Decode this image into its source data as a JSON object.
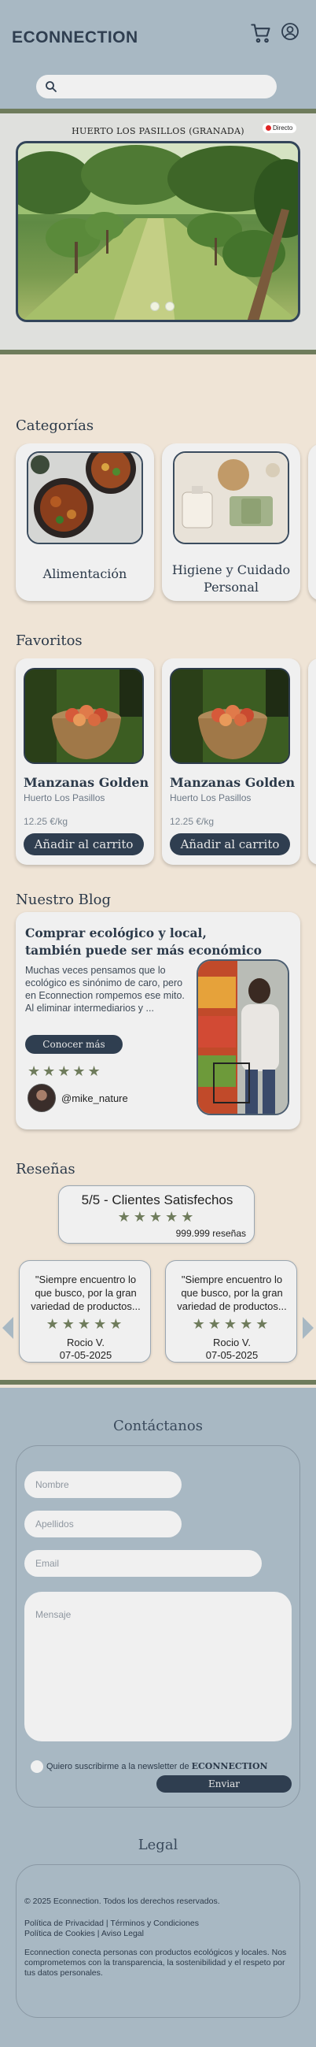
{
  "header": {
    "logo": "ECONNECTION",
    "search_placeholder": "",
    "icons": [
      "cart-icon",
      "user-icon",
      "search-icon"
    ]
  },
  "hero": {
    "title": "HUERTO LOS PASILLOS (GRANADA)",
    "live_label": "Directo",
    "slides_total": 2,
    "active_slide": 1
  },
  "categories": {
    "title": "Categorías",
    "items": [
      {
        "label": "Alimentación"
      },
      {
        "label_line1": "Higiene y Cuidado",
        "label_line2": "Personal"
      }
    ]
  },
  "favorites": {
    "title": "Favoritos",
    "items": [
      {
        "name": "Manzanas Golden",
        "farm": "Huerto Los Pasillos",
        "price": "12.25 €/kg",
        "button": "Añadir al carrito"
      },
      {
        "name": "Manzanas Golden",
        "farm": "Huerto Los Pasillos",
        "price": "12.25 €/kg",
        "button": "Añadir al carrito"
      }
    ]
  },
  "blog": {
    "title": "Nuestro Blog",
    "post_title_line1": "Comprar ecológico y local,",
    "post_title_line2": "también puede ser más económico",
    "excerpt": "Muchas veces pensamos que lo ecológico es sinónimo de caro, pero en Econnection rompemos ese mito. Al eliminar intermediarios y ...",
    "button": "Conocer más",
    "rating": 5,
    "author": "@mike_nature"
  },
  "reviews": {
    "title": "Reseñas",
    "summary": "5/5 - Clientes Satisfechos",
    "summary_rating": 5,
    "count": "999.999 reseñas",
    "items": [
      {
        "quote_line1": "\"Siempre encuentro lo",
        "quote_line2": "que busco, por la gran",
        "quote_line3": "variedad de productos...",
        "rating": 5,
        "author": "Rocio V.",
        "date": "07-05-2025"
      },
      {
        "quote_line1": "\"Siempre encuentro lo",
        "quote_line2": "que busco, por la gran",
        "quote_line3": "variedad de productos...",
        "rating": 5,
        "author": "Rocio V.",
        "date": "07-05-2025"
      }
    ]
  },
  "contact": {
    "title": "Contáctanos",
    "name_placeholder": "Nombre",
    "surname_placeholder": "Apellidos",
    "email_placeholder": "Email",
    "message_placeholder": "Mensaje",
    "newsletter_label": "Quiero suscribirme a la newsletter de ",
    "newsletter_brand": "ECONNECTION",
    "send_button": "Enviar"
  },
  "legal": {
    "title": "Legal",
    "copyright": "© 2025 Econnection. Todos los derechos reservados.",
    "links_line1": "Política de Privacidad | Términos y Condiciones",
    "links_line2": "Política de Cookies | Aviso Legal",
    "about": "Econnection conecta personas con productos ecológicos y locales. Nos comprometemos con la transparencia, la sostenibilidad y el respeto por tus datos personales."
  },
  "colors": {
    "header_bg": "#a8b8c3",
    "body_bg": "#efe4d6",
    "accent_green": "#6f7c5c",
    "button_dark": "#2f3e50",
    "live_red": "#e02424"
  }
}
